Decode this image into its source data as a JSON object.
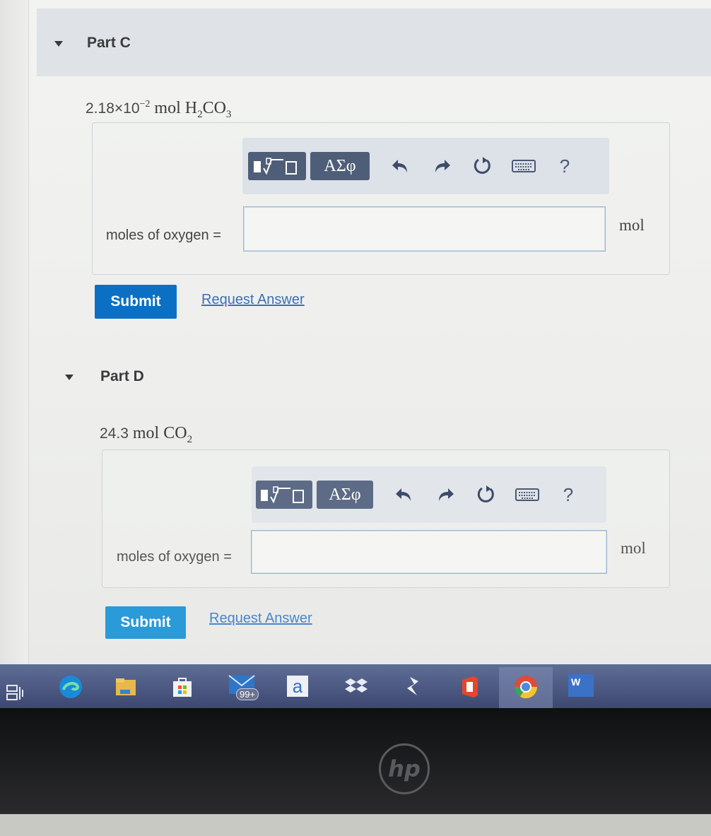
{
  "partC": {
    "title": "Part C",
    "question_prefix": "2.18×10",
    "question_exp": "−2",
    "question_unit": "mol H",
    "question_sub1": "2",
    "question_mid": "CO",
    "question_sub2": "3",
    "greek_label": "ΑΣφ",
    "help": "?",
    "field_label": "moles of oxygen =",
    "field_value": "",
    "unit": "mol",
    "submit": "Submit",
    "request": "Request Answer"
  },
  "partD": {
    "title": "Part D",
    "question_prefix": "24.3",
    "question_unit": "mol CO",
    "question_sub": "2",
    "greek_label": "ΑΣφ",
    "help": "?",
    "field_label": "moles of oxygen =",
    "field_value": "",
    "unit": "mol",
    "submit": "Submit",
    "request": "Request Answer"
  },
  "taskbar": {
    "mail_badge": "99+",
    "amazon_letter": "a",
    "word_letter": "W"
  },
  "brand": "hp",
  "colors": {
    "submit_active": "#0b70c4",
    "submit_faded": "#2a9ad8",
    "toolbar_button": "#4f5e78",
    "link": "#3c6fb8"
  },
  "icons": [
    "templates-icon",
    "greek-symbols-icon",
    "undo-icon",
    "redo-icon",
    "reset-icon",
    "keyboard-icon",
    "help-icon"
  ]
}
